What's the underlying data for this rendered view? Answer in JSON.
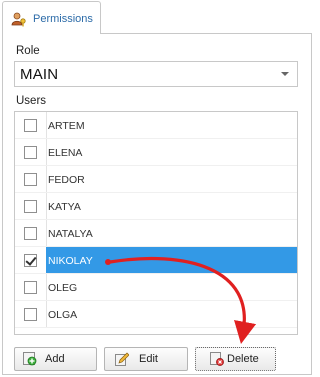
{
  "tab": {
    "label": "Permissions",
    "icon": "users-key-icon"
  },
  "role": {
    "label": "Role",
    "value": "MAIN"
  },
  "users": {
    "label": "Users",
    "items": [
      {
        "name": "ARTEM",
        "checked": false,
        "selected": false
      },
      {
        "name": "ELENA",
        "checked": false,
        "selected": false
      },
      {
        "name": "FEDOR",
        "checked": false,
        "selected": false
      },
      {
        "name": "KATYA",
        "checked": false,
        "selected": false
      },
      {
        "name": "NATALYA",
        "checked": false,
        "selected": false
      },
      {
        "name": "NIKOLAY",
        "checked": true,
        "selected": true
      },
      {
        "name": "OLEG",
        "checked": false,
        "selected": false
      },
      {
        "name": "OLGA",
        "checked": false,
        "selected": false
      }
    ]
  },
  "buttons": {
    "add": "Add",
    "edit": "Edit",
    "delete": "Delete"
  },
  "colors": {
    "selection": "#3399e6",
    "accent_link": "#2c6ba8",
    "annotation_arrow": "#e02020"
  }
}
